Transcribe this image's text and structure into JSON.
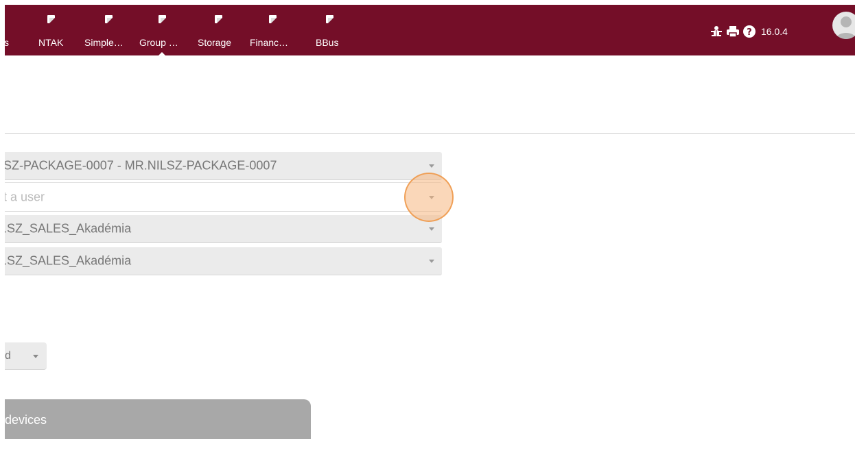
{
  "nav": {
    "items": [
      {
        "label": "s"
      },
      {
        "label": "NTAK"
      },
      {
        "label": "Simple…"
      },
      {
        "label": "Group …"
      },
      {
        "label": "Storage"
      },
      {
        "label": "Financ…"
      },
      {
        "label": "BBus"
      }
    ],
    "active_index": 3,
    "version": "16.0.4",
    "icons": [
      "bug-icon",
      "print-icon",
      "help-icon",
      "user-avatar"
    ]
  },
  "form": {
    "package_select": {
      "value": "SZ-PACKAGE-0007 - MR.NILSZ-PACKAGE-0007"
    },
    "user_select": {
      "placeholder": "t a user"
    },
    "group_select_1": {
      "value": ".SZ_SALES_Akadémia"
    },
    "group_select_2": {
      "value": ".SZ_SALES_Akadémia"
    },
    "small_select": {
      "value": "d"
    }
  },
  "tab": {
    "label": "devices"
  },
  "colors": {
    "topbar": "#740e28",
    "select_bg": "#ebebeb",
    "tab_bg": "#a8a8a8",
    "click_marker": "#f6b680"
  }
}
